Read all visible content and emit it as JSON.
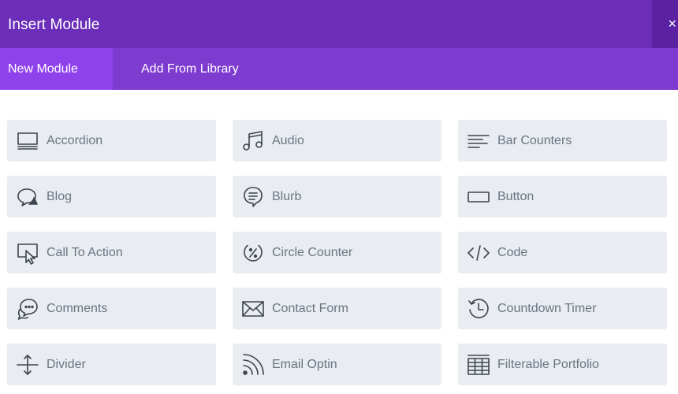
{
  "header": {
    "title": "Insert Module",
    "close_label": "×"
  },
  "tabs": [
    {
      "label": "New Module",
      "active": true
    },
    {
      "label": "Add From Library",
      "active": false
    }
  ],
  "modules": [
    {
      "label": "Accordion",
      "icon": "accordion-icon"
    },
    {
      "label": "Audio",
      "icon": "music-note-icon"
    },
    {
      "label": "Bar Counters",
      "icon": "bar-counters-icon"
    },
    {
      "label": "Blog",
      "icon": "blog-icon"
    },
    {
      "label": "Blurb",
      "icon": "blurb-icon"
    },
    {
      "label": "Button",
      "icon": "button-icon"
    },
    {
      "label": "Call To Action",
      "icon": "call-to-action-icon"
    },
    {
      "label": "Circle Counter",
      "icon": "circle-counter-icon"
    },
    {
      "label": "Code",
      "icon": "code-icon"
    },
    {
      "label": "Comments",
      "icon": "comments-icon"
    },
    {
      "label": "Contact Form",
      "icon": "envelope-icon"
    },
    {
      "label": "Countdown Timer",
      "icon": "countdown-timer-icon"
    },
    {
      "label": "Divider",
      "icon": "divider-icon"
    },
    {
      "label": "Email Optin",
      "icon": "rss-icon"
    },
    {
      "label": "Filterable Portfolio",
      "icon": "grid-table-icon"
    }
  ],
  "colors": {
    "header_bg": "#6c2eb9",
    "tabs_bg": "#7e3bd0",
    "active_tab_bg": "#8f42ec",
    "item_bg": "#e9ecf0",
    "item_text": "#6b7683",
    "icon_stroke": "#3d4550"
  }
}
